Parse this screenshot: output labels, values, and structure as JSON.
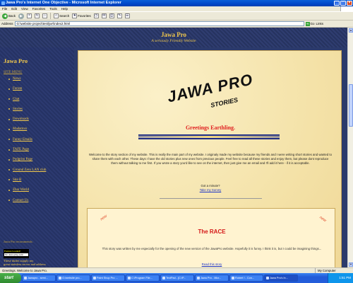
{
  "window": {
    "title": "Jawa Pro's Internet One Objective - Microsoft Internet Explorer"
  },
  "menu": [
    "File",
    "Edit",
    "View",
    "Favorites",
    "Tools",
    "Help"
  ],
  "toolbar": {
    "back": "Back",
    "search": "Search",
    "favorites": "Favorites"
  },
  "address": {
    "label": "Address",
    "url": "G:\\website project\\test\\jwr\\index2.html",
    "go": "Go",
    "links": "Links"
  },
  "site": {
    "title": "Jawa Pro",
    "tagline": "A seriously Friendly Website",
    "sidebar_title": "Jawa Pro",
    "menu_label": "SITE MENU",
    "menu_items": [
      "News",
      "Forum",
      "Chat",
      "Stories",
      "Downloads",
      "Madattors",
      "Funny Emails",
      "TAFE Page",
      "Podgrim Page",
      "Ground Zero LAN club",
      "Site B",
      "Zhar World",
      "Contact Us"
    ],
    "recommends": "Jawa Pro recommends:",
    "badge_line1": "Feature Loaded!",
    "badge_line2": "No Annoying Ads!",
    "footer_text": "These dudes supply my",
    "footer_text2": "great stainless server and address"
  },
  "page": {
    "logo_main": "JAWA PRO",
    "logo_sub": "STORIES",
    "greeting": "Greetings Earthling.",
    "intro": "Welcome to the story section of my website. This is really the main part of my website. I originaly made my website because my friends and I were writing short stories and wanted to share them with each other. These days I have the old stories plus new ones from previous people. Feel free to read all these stories and enjoy them, but please dont reproduce them without talking to me first. If you wrote a story you'd like to see on the internet, then just give me an email and I'll add it here - if it is acceptable.",
    "survey_question": "Got a minute?",
    "survey_link": "Take my Survey",
    "story_new_label": "new",
    "story_title": "The RACE",
    "story_text": "This story was written by me especially for the opening of the new version of the JawaPro website. Hopefully it is funny. I think it is, but I could be imagining things...",
    "story_link": "Read this story"
  },
  "status": {
    "text": "Greetings.    Welcome to Jawa Pro.",
    "zone": "My Computer"
  },
  "taskbar": {
    "start": "start",
    "tasks": [
      "Jawapro - semi...",
      "G:\\website pro...",
      "Paint Shop Pro ...",
      "C:\\Program File...",
      "TextPad - [C:\\P...",
      "Jawa Pro - Micr...",
      "Robert ! - Con...",
      "Jawa Pro's In..."
    ],
    "clock": "1:51 PM"
  }
}
